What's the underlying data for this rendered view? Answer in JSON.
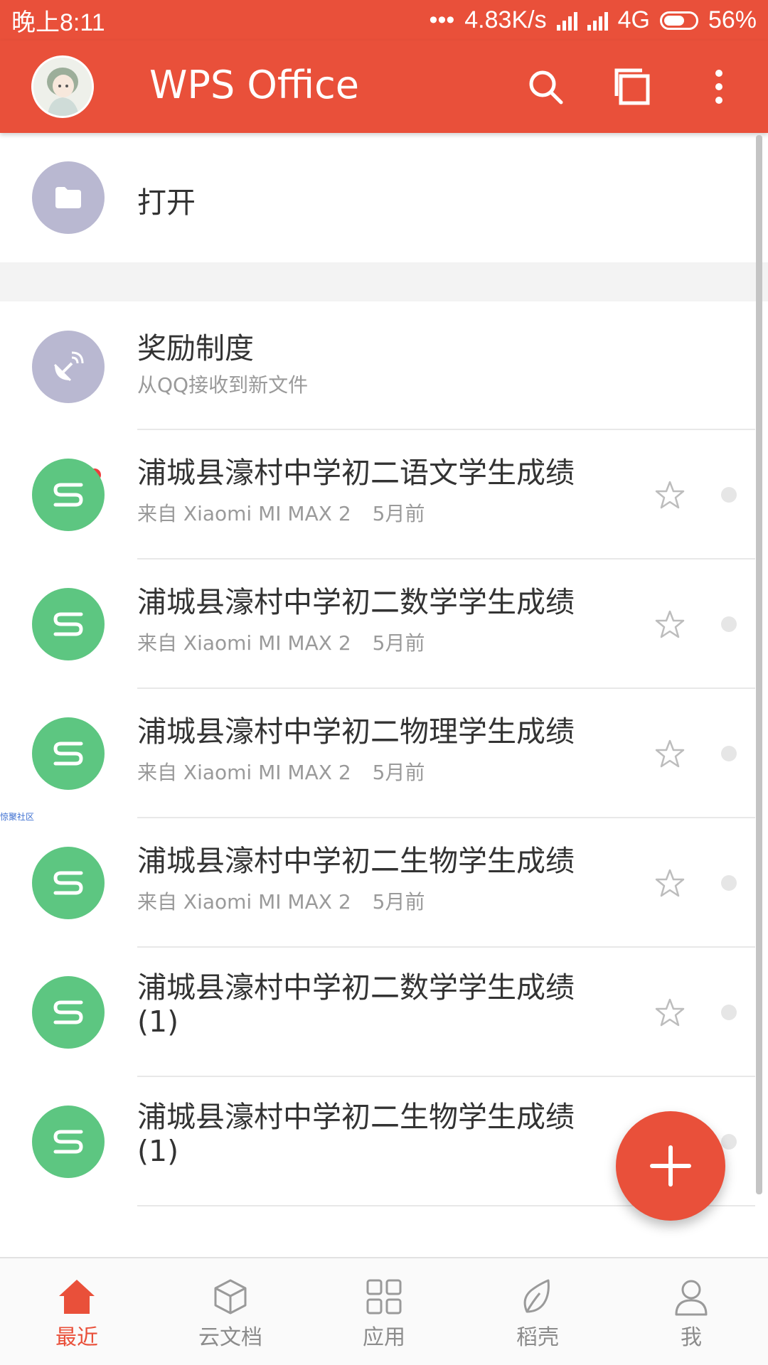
{
  "status_bar": {
    "time": "晚上8:11",
    "dots": "•••",
    "network_speed": "4.83K/s",
    "network_type": "4G",
    "battery": "56%"
  },
  "app_bar": {
    "title": "WPS Office",
    "icons": [
      "avatar",
      "search-icon",
      "multi-window-icon",
      "more-vert-icon"
    ]
  },
  "open_item": {
    "label": "打开",
    "icon": "folder-icon"
  },
  "reward_item": {
    "title": "奖励制度",
    "subtitle": "从QQ接收到新文件",
    "icon": "satellite-dish-icon"
  },
  "files": [
    {
      "title": "浦城县濠村中学初二语文学生成绩",
      "source": "来自 Xiaomi MI MAX 2",
      "time": "5月前"
    },
    {
      "title": "浦城县濠村中学初二数学学生成绩",
      "source": "来自 Xiaomi MI MAX 2",
      "time": "5月前"
    },
    {
      "title": "浦城县濠村中学初二物理学生成绩",
      "source": "来自 Xiaomi MI MAX 2",
      "time": "5月前"
    },
    {
      "title": "浦城县濠村中学初二生物学生成绩",
      "source": "来自 Xiaomi MI MAX 2",
      "time": "5月前"
    },
    {
      "title": "浦城县濠村中学初二数学学生成绩",
      "title_line2": "(1)"
    },
    {
      "title": "浦城县濠村中学初二生物学生成绩",
      "title_line2": "(1)"
    }
  ],
  "watermark": "惊聚社区",
  "bottom_nav": [
    {
      "label": "最近",
      "icon": "home-icon",
      "active": true
    },
    {
      "label": "云文档",
      "icon": "cloud-doc-cube-icon",
      "active": false
    },
    {
      "label": "应用",
      "icon": "apps-grid-icon",
      "active": false
    },
    {
      "label": "稻壳",
      "icon": "leaf-icon",
      "active": false
    },
    {
      "label": "我",
      "icon": "person-icon",
      "active": false
    }
  ],
  "colors": {
    "brand": "#e9503a",
    "file_icon": "#5dc681",
    "folder_icon": "#b9b8d1",
    "badge": "#f03c3c"
  }
}
